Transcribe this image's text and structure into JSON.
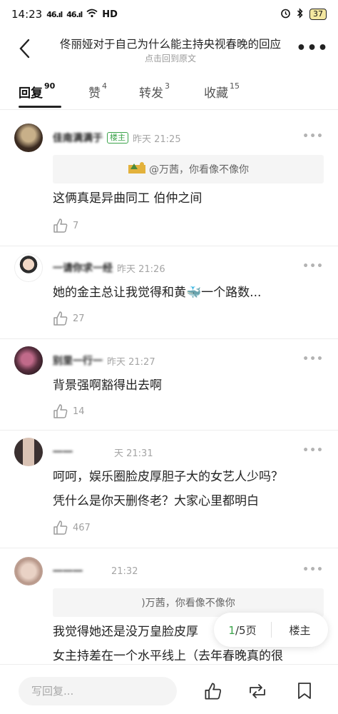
{
  "status_bar": {
    "time": "14:23",
    "signal1": "46.ıl",
    "signal2": "46.ıl",
    "network": "HD",
    "battery": "37"
  },
  "header": {
    "title": "佟丽娅对于自己为什么能主持央视春晚的回应",
    "subtitle": "点击回到原文"
  },
  "tabs": [
    {
      "label": "回复",
      "count": "90"
    },
    {
      "label": "赞",
      "count": "4"
    },
    {
      "label": "转发",
      "count": "3"
    },
    {
      "label": "收藏",
      "count": "15"
    }
  ],
  "comments": [
    {
      "username": "佳南满满于",
      "badge": "楼主",
      "time": "昨天 21:25",
      "quote": "@万茜，你看像不像你",
      "text": [
        "这俩真是异曲同工 伯仲之间"
      ],
      "likes": "7"
    },
    {
      "username": "一请你求一经",
      "time": "昨天 21:26",
      "text": [
        "她的金主总让我觉得和黄🐳一个路数..."
      ],
      "likes": "27"
    },
    {
      "username": "别里一行一",
      "time": "昨天 21:27",
      "text": [
        "背景强啊豁得出去啊"
      ],
      "likes": "14"
    },
    {
      "username": "一一",
      "time": "天 21:31",
      "text": [
        "呵呵，娱乐圈脸皮厚胆子大的女艺人少吗？",
        "凭什么是你天删佟老？大家心里都明白"
      ],
      "likes": "467"
    },
    {
      "username": "一一一",
      "time": "21:32",
      "quote": ")万茜，你看像不像你",
      "text": [
        "我觉得她还是没万皇脸皮厚",
        "女主持差在一个水平线上（去年春晚真的很"
      ]
    }
  ],
  "pager": {
    "current": "1",
    "total_suffix": "/5页",
    "op_label": "楼主"
  },
  "bottom": {
    "reply_placeholder": "写回复..."
  }
}
